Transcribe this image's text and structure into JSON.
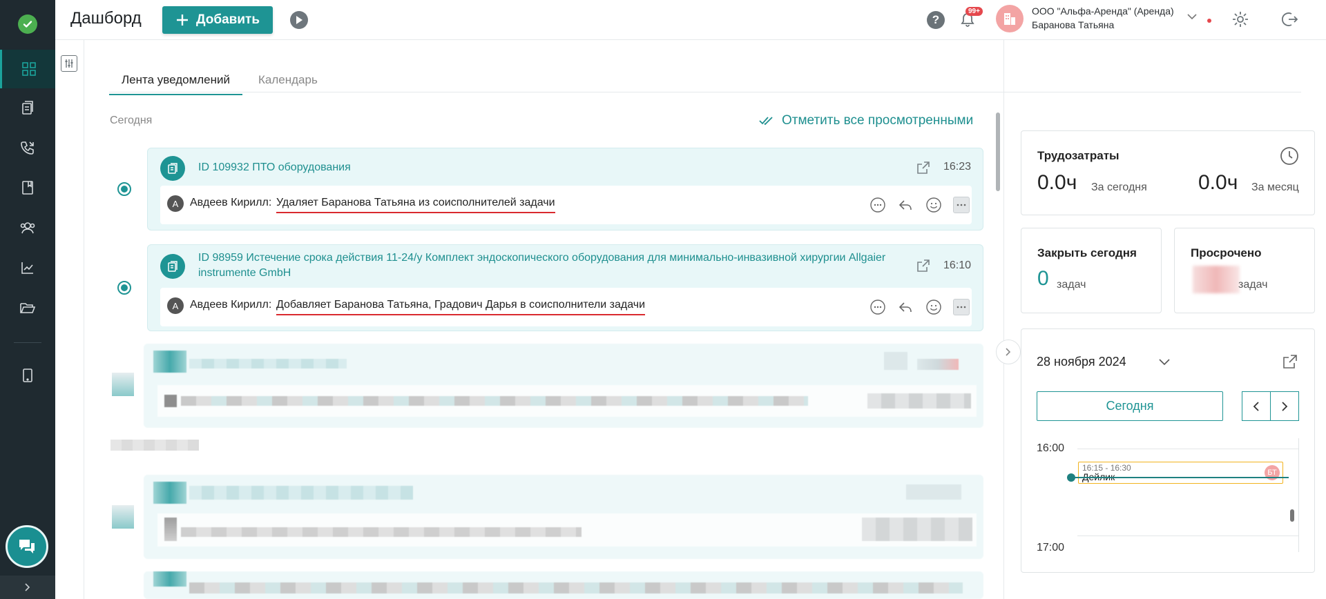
{
  "header": {
    "title": "Дашборд",
    "add_label": "Добавить",
    "notifications_badge": "99+",
    "org_line1": "ООО \"Альфа-Аренда\" (Аренда)",
    "org_line2": "Баранова Татьяна"
  },
  "tabs": [
    {
      "label": "Лента уведомлений",
      "active": true
    },
    {
      "label": "Календарь",
      "active": false
    }
  ],
  "feed": {
    "today_label": "Сегодня",
    "mark_all_label": "Отметить все просмотренными",
    "items": [
      {
        "title": "ID 109932 ПТО оборудования",
        "time": "16:23",
        "avatar_letter": "А",
        "author": "Авдеев Кирилл:",
        "message": "Удаляет Баранова Татьяна из соисполнителей задачи"
      },
      {
        "title": "ID 98959 Истечение срока действия 11-24/у Комплект эндоскопического оборудования для минимально-инвазивной хирургии Allgaier instrumente GmbH",
        "time": "16:10",
        "avatar_letter": "А",
        "author": "Авдеев Кирилл:",
        "message": "Добавляет Баранова Татьяна, Градович Дарья в соисполнители задачи"
      }
    ]
  },
  "labor": {
    "title": "Трудозатраты",
    "today_value": "0.0ч",
    "today_label": "За сегодня",
    "month_value": "0.0ч",
    "month_label": "За месяц"
  },
  "close_today": {
    "title": "Закрыть сегодня",
    "value": "0",
    "unit": "задач"
  },
  "overdue": {
    "title": "Просрочено",
    "unit": "задач"
  },
  "calendar": {
    "date": "28 ноября 2024",
    "today_button": "Сегодня",
    "hours": [
      "16:00",
      "17:00"
    ],
    "event": {
      "time": "16:15 - 16:30",
      "name": "Дейлик",
      "avatar": "БТ"
    }
  },
  "colors": {
    "accent": "#1e9494",
    "nav_bg": "#1f2a30",
    "underline_red": "#d9292e",
    "event_border": "#f2b31d"
  }
}
